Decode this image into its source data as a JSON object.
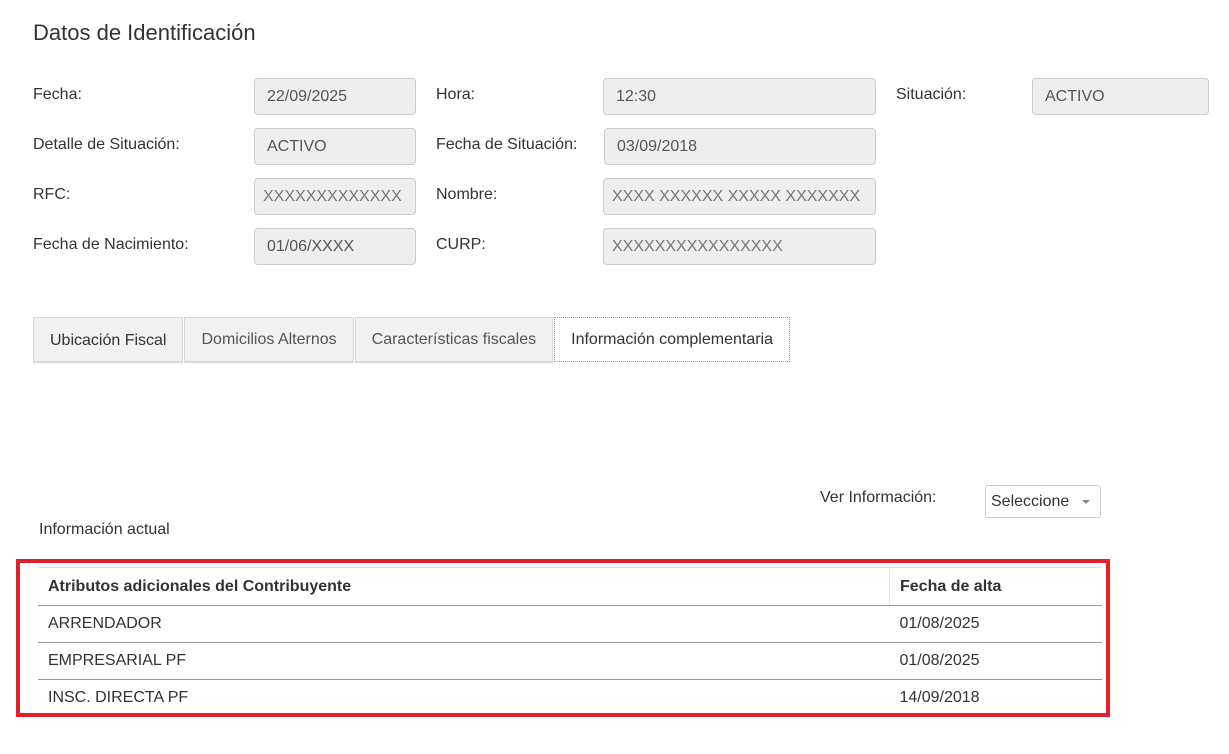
{
  "title": "Datos de Identificación",
  "fields": {
    "fecha": {
      "label": "Fecha:",
      "value": "22/09/2025"
    },
    "hora": {
      "label": "Hora:",
      "value": "12:30"
    },
    "situacion": {
      "label": "Situación:",
      "value": "ACTIVO"
    },
    "detalle_situacion": {
      "label": "Detalle de Situación:",
      "value": "ACTIVO"
    },
    "fecha_situacion": {
      "label": "Fecha de Situación:",
      "value": "03/09/2018"
    },
    "rfc": {
      "label": "RFC:",
      "value": "XXXXXXXXXXXXX"
    },
    "nombre": {
      "label": "Nombre:",
      "value": "XXXX XXXXXX XXXXX XXXXXXX"
    },
    "fecha_nacimiento": {
      "label": "Fecha de Nacimiento:",
      "value": "01/06/XXXX"
    },
    "curp": {
      "label": "CURP:",
      "value": "XXXXXXXXXXXXXXXX"
    }
  },
  "tabs": [
    {
      "label": "Ubicación Fiscal",
      "active": false
    },
    {
      "label": "Domicilios Alternos",
      "active": false
    },
    {
      "label": "Características fiscales",
      "active": false
    },
    {
      "label": "Información complementaria",
      "active": true
    }
  ],
  "ver_informacion": {
    "label": "Ver Información:",
    "selected": "Seleccione"
  },
  "section_label": "Información actual",
  "table": {
    "headers": [
      "Atributos adicionales del Contribuyente",
      "Fecha de alta"
    ],
    "rows": [
      [
        "ARRENDADOR",
        "01/08/2025"
      ],
      [
        "EMPRESARIAL PF",
        "01/08/2025"
      ],
      [
        "INSC. DIRECTA PF",
        "14/09/2018"
      ]
    ]
  },
  "colors": {
    "highlight_border": "#e0202a",
    "field_background": "#eeeeee"
  }
}
